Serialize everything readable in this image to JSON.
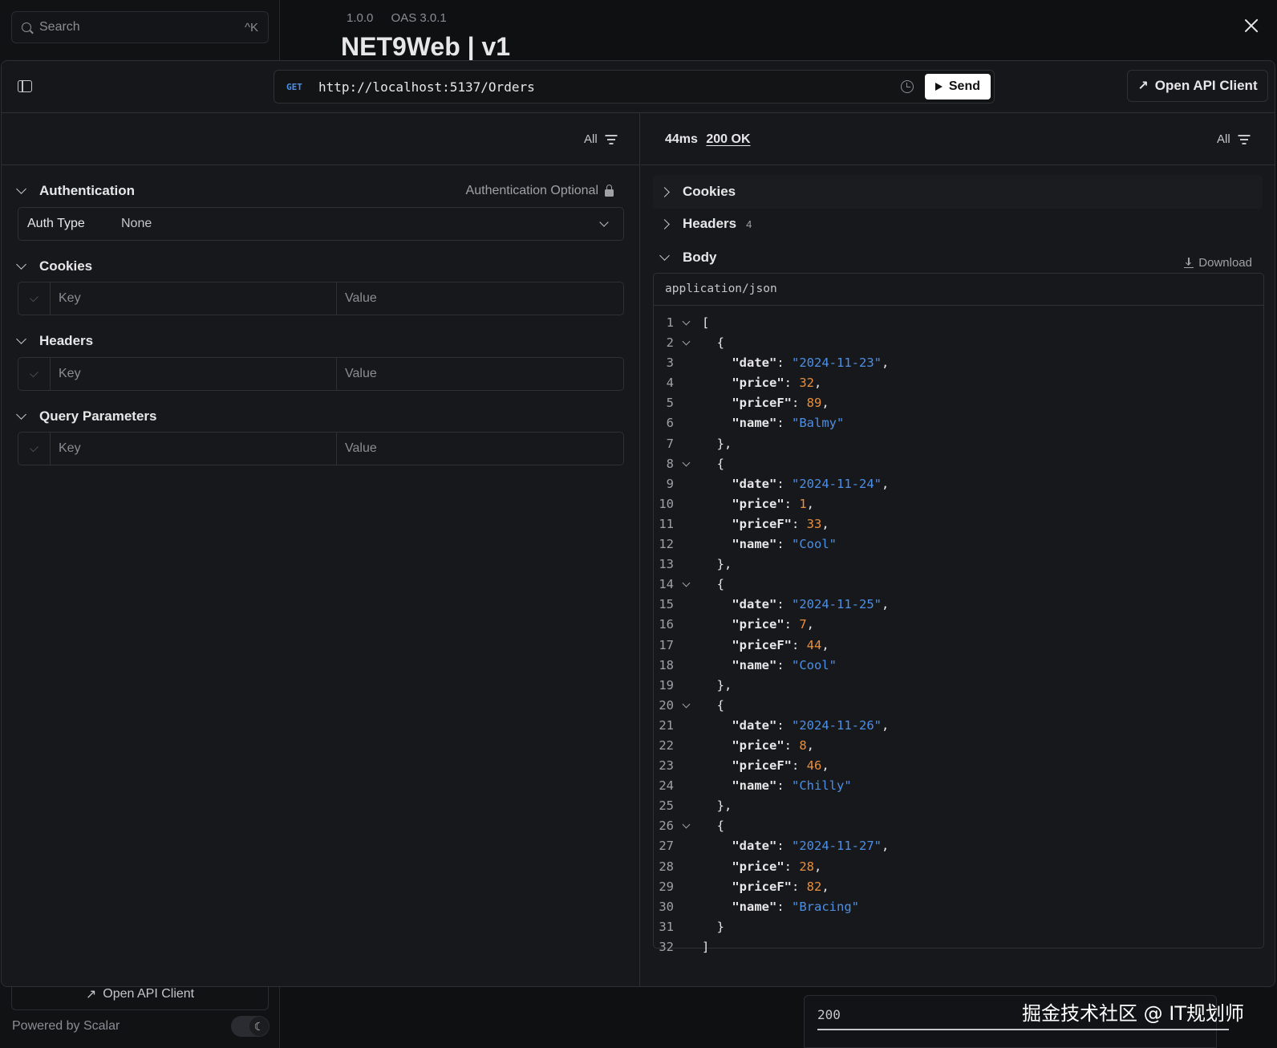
{
  "background": {
    "search": {
      "placeholder": "Search",
      "shortcut": "^K"
    },
    "version": "1.0.0",
    "oas": "OAS 3.0.1",
    "title": "NET9Web | v1",
    "open_client": "Open API Client",
    "powered_by": "Powered by Scalar",
    "status_tab": "200",
    "watermark": "掘金技术社区 @ IT规划师"
  },
  "modal": {
    "sidebar_toggle_icon": "sidebar-panel-icon",
    "request": {
      "method": "GET",
      "url": "http://localhost:5137/Orders",
      "send_label": "Send"
    },
    "open_client_label": "Open API Client",
    "left": {
      "filter_label": "All",
      "auth": {
        "title": "Authentication",
        "optional_label": "Authentication Optional",
        "type_label": "Auth Type",
        "type_value": "None"
      },
      "cookies": {
        "title": "Cookies",
        "key_placeholder": "Key",
        "value_placeholder": "Value"
      },
      "headers": {
        "title": "Headers",
        "key_placeholder": "Key",
        "value_placeholder": "Value"
      },
      "query": {
        "title": "Query Parameters",
        "key_placeholder": "Key",
        "value_placeholder": "Value"
      }
    },
    "right": {
      "time": "44ms",
      "status": "200 OK",
      "filter_label": "All",
      "cookies_title": "Cookies",
      "headers_title": "Headers",
      "headers_count": "4",
      "body_title": "Body",
      "download_label": "Download",
      "content_type": "application/json",
      "body_items": [
        {
          "date": "2024-11-23",
          "price": 32,
          "priceF": 89,
          "name": "Balmy"
        },
        {
          "date": "2024-11-24",
          "price": 1,
          "priceF": 33,
          "name": "Cool"
        },
        {
          "date": "2024-11-25",
          "price": 7,
          "priceF": 44,
          "name": "Cool"
        },
        {
          "date": "2024-11-26",
          "price": 8,
          "priceF": 46,
          "name": "Chilly"
        },
        {
          "date": "2024-11-27",
          "price": 28,
          "priceF": 82,
          "name": "Bracing"
        }
      ]
    }
  }
}
